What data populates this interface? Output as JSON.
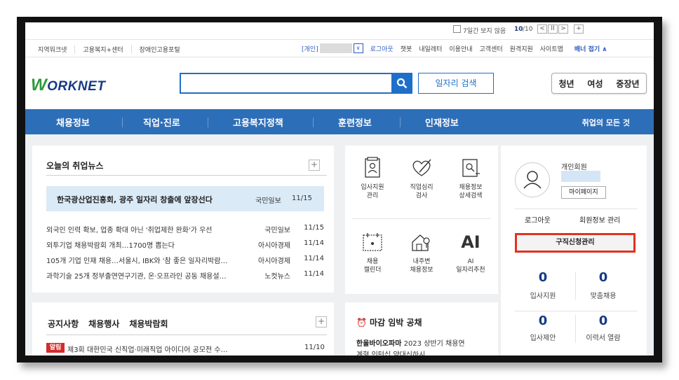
{
  "top_bar": {
    "hide7days_label": "7일간 보지 않음",
    "page_current": "10",
    "page_total": "/10",
    "prev": "<",
    "pause": "II",
    "next": ">",
    "add": "+"
  },
  "utility": {
    "left_links": [
      "지역워크넷",
      "고용복지+센터",
      "장애인고용포털"
    ],
    "user_type": "[개인]",
    "chevron": "∨",
    "logout": "로그아웃",
    "links": [
      "챗봇",
      "내일레터",
      "이용안내",
      "고객센터",
      "원격지원",
      "사이트맵"
    ],
    "banner_toggle": "배너 접기 ∧"
  },
  "header": {
    "logo_w": "W",
    "logo_rest": "ORKNET",
    "search_placeholder": "",
    "search_icon": "⚲",
    "job_search": "일자리 검색",
    "segments": [
      "청년",
      "여성",
      "중장년"
    ]
  },
  "nav": {
    "items": [
      "채용정보",
      "직업·진로",
      "고용복지정책",
      "훈련정보",
      "인재정보"
    ],
    "all": "취업의 모든 것"
  },
  "news": {
    "title": "오늘의 취업뉴스",
    "plus": "+",
    "featured": {
      "title": "한국광산업진흥회, 광주 일자리 창출에 앞장선다",
      "source": "국민일보",
      "date": "11/15"
    },
    "rows": [
      {
        "title": "외국인 인력 확보, 업종 확대 아닌 '취업제한 완화'가 우선",
        "source": "국민일보",
        "date": "11/15"
      },
      {
        "title": "외투기업 채용박람회 개최…1700명 뽑는다",
        "source": "아시아경제",
        "date": "11/14"
      },
      {
        "title": "105개 기업 인재 채용…서울시, IBK와 '참 좋은 일자리박람…",
        "source": "아시아경제",
        "date": "11/14"
      },
      {
        "title": "과학기술 25개 정부출연연구기관, 온·오프라인 공동 채용설…",
        "source": "노컷뉴스",
        "date": "11/14"
      }
    ]
  },
  "services": {
    "items": [
      {
        "label1": "입사지원",
        "label2": "관리"
      },
      {
        "label1": "직업심리",
        "label2": "검사"
      },
      {
        "label1": "채용정보",
        "label2": "상세검색"
      },
      {
        "label1": "채용",
        "label2": "캘린더"
      },
      {
        "label1": "내주변",
        "label2": "채용정보"
      },
      {
        "label1": "AI",
        "label2": "일자리추천"
      }
    ],
    "ai_glyph": "AI"
  },
  "member": {
    "type": "개인회원",
    "mypage": "마이페이지",
    "logout": "로그아웃",
    "manage": "회원정보 관리",
    "apply_manage": "구직신청관리",
    "stats": [
      {
        "value": "0",
        "label": "입사지원"
      },
      {
        "value": "0",
        "label": "맞춤채용"
      },
      {
        "value": "0",
        "label": "입사제안"
      },
      {
        "value": "0",
        "label": "이력서 열람"
      }
    ]
  },
  "notice": {
    "tabs": [
      "공지사항",
      "채용행사",
      "채용박람회"
    ],
    "plus": "+",
    "badge": "알림",
    "text": "제3회 대한민국 신직업·미래직업 아이디어 공모전 수…",
    "date": "11/10"
  },
  "deadline": {
    "clock": "⏰",
    "title": "마감 임박 공채",
    "company": "한울바이오파마",
    "desc": " 2023 상반기 채용연",
    "next_line": "계형 인턴십  약대신하시"
  }
}
